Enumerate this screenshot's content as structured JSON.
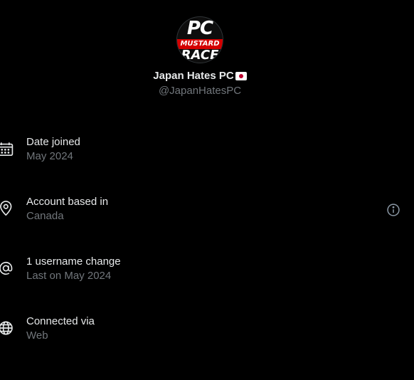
{
  "profile": {
    "avatar_text_top": "PC",
    "avatar_text_band": "MUSTARD",
    "avatar_text_bottom": "RACE",
    "display_name": "Japan Hates PC",
    "handle": "@JapanHatesPC",
    "flag_icon": "japan-flag-icon"
  },
  "rows": [
    {
      "icon": "calendar-icon",
      "label": "Date joined",
      "value": "May 2024"
    },
    {
      "icon": "location-pin-icon",
      "label": "Account based in",
      "value": "Canada",
      "has_info": true
    },
    {
      "icon": "at-sign-icon",
      "label": "1 username change",
      "value": "Last on May 2024"
    },
    {
      "icon": "globe-icon",
      "label": "Connected via",
      "value": "Web"
    }
  ],
  "colors": {
    "background": "#000000",
    "primary_text": "#e7e9ea",
    "secondary_text": "#71767b",
    "flag_red": "#bc002d"
  }
}
